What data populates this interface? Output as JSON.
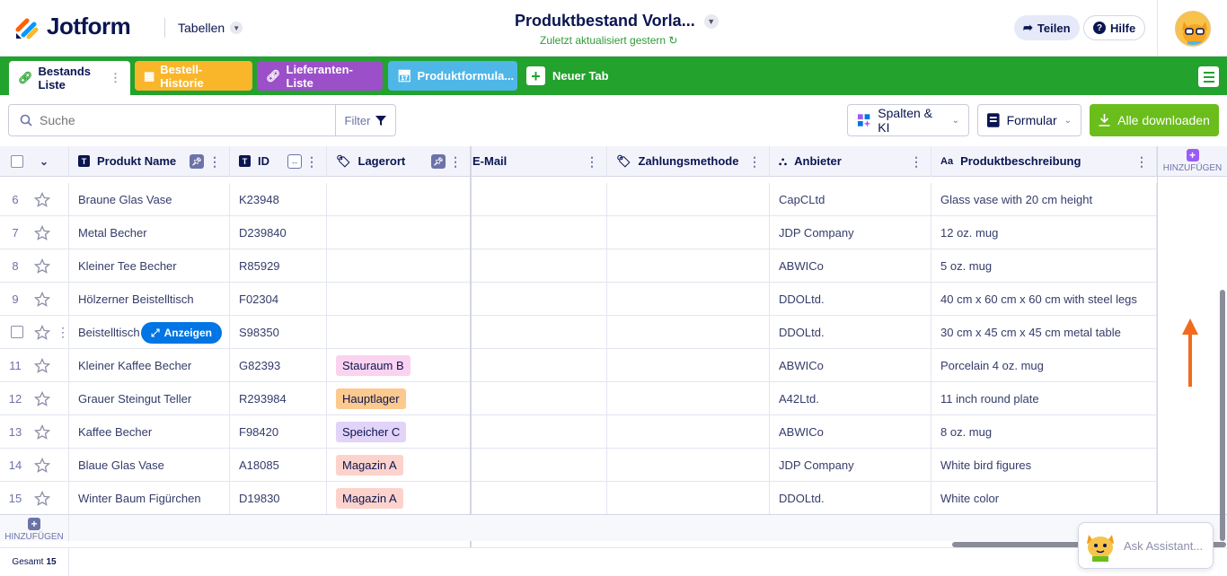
{
  "header": {
    "brand": "Jotform",
    "tables_label": "Tabellen",
    "title": "Produktbestand Vorla...",
    "subtitle": "Zuletzt aktualisiert gestern",
    "share_label": "Teilen",
    "help_label": "Hilfe"
  },
  "tabs": [
    {
      "label": "Bestands Liste",
      "color": "#ffffff"
    },
    {
      "label": "Bestell-Historie",
      "color": "#f9b62a"
    },
    {
      "label": "Lieferanten-Liste",
      "color": "#9b4fc8"
    },
    {
      "label": "Produktformula...",
      "color": "#4fb6e8"
    }
  ],
  "new_tab_label": "Neuer Tab",
  "toolbar": {
    "search_placeholder": "Suche",
    "filter_label": "Filter",
    "columns_label": "Spalten & KI",
    "form_label": "Formular",
    "download_label": "Alle downloaden"
  },
  "columns": {
    "name": "Produkt Name",
    "id": "ID",
    "location": "Lagerort",
    "email": "E-Mail",
    "payment": "Zahlungsmethode",
    "supplier": "Anbieter",
    "description": "Produktbeschreibung",
    "add": "HINZUFÜGEN"
  },
  "rows": [
    {
      "n": "6",
      "name": "Braune Glas Vase",
      "id": "K23948",
      "loc": "",
      "supplier": "CapCLtd",
      "desc": "Glass vase with 20 cm height"
    },
    {
      "n": "7",
      "name": "Metal Becher",
      "id": "D239840",
      "loc": "",
      "supplier": "JDP Company",
      "desc": "12 oz. mug"
    },
    {
      "n": "8",
      "name": "Kleiner Tee Becher",
      "id": "R85929",
      "loc": "",
      "supplier": "ABWICo",
      "desc": "5 oz. mug"
    },
    {
      "n": "9",
      "name": "Hölzerner Beistelltisch",
      "id": "F02304",
      "loc": "",
      "supplier": "DDOLtd.",
      "desc": "40 cm x 60 cm x 60 cm with steel legs"
    },
    {
      "n": "",
      "name": "Beistelltisch",
      "id": "S98350",
      "loc": "",
      "supplier": "DDOLtd.",
      "desc": "30 cm x 45 cm x 45 cm metal table"
    },
    {
      "n": "11",
      "name": "Kleiner Kaffee Becher",
      "id": "G82393",
      "loc": "Stauraum B",
      "supplier": "ABWICo",
      "desc": "Porcelain 4 oz. mug"
    },
    {
      "n": "12",
      "name": "Grauer Steingut Teller",
      "id": "R293984",
      "loc": "Hauptlager",
      "supplier": "A42Ltd.",
      "desc": "11 inch round plate"
    },
    {
      "n": "13",
      "name": "Kaffee Becher",
      "id": "F98420",
      "loc": "Speicher C",
      "supplier": "ABWICo",
      "desc": "8 oz. mug"
    },
    {
      "n": "14",
      "name": "Blaue Glas Vase",
      "id": "A18085",
      "loc": "Magazin A",
      "supplier": "JDP Company",
      "desc": "White bird figures"
    },
    {
      "n": "15",
      "name": "Winter Baum Figürchen",
      "id": "D19830",
      "loc": "Magazin A",
      "supplier": "DDOLtd.",
      "desc": "White color"
    }
  ],
  "location_colors": {
    "Stauraum B": "#f9d3ef",
    "Hauptlager": "#fcc98f",
    "Speicher C": "#e2d3f9",
    "Magazin A": "#fcd3cc"
  },
  "anzeigen_label": "Anzeigen",
  "footer": {
    "add_label": "HINZUFÜGEN",
    "total_label": "Gesamt",
    "total_count": "15"
  },
  "assistant_placeholder": "Ask Assistant..."
}
